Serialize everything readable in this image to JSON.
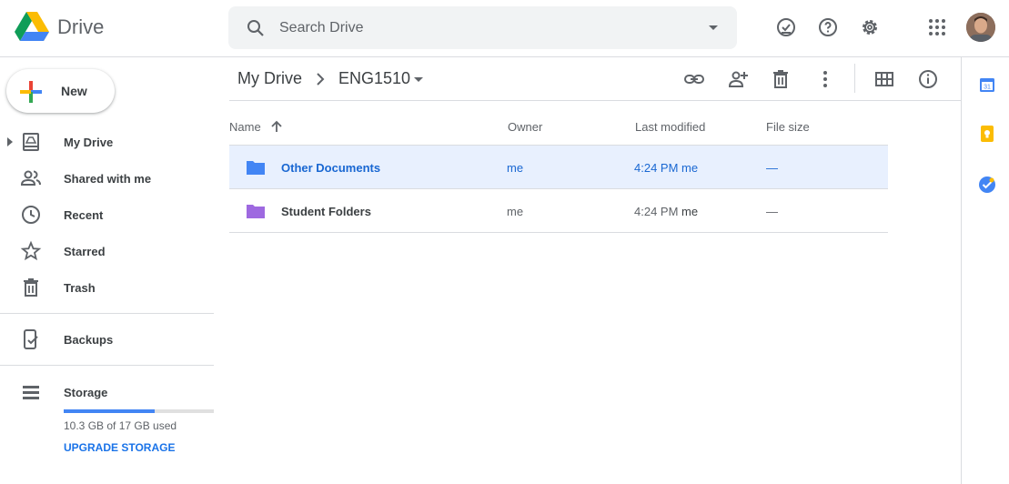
{
  "app": {
    "name": "Drive"
  },
  "search": {
    "placeholder": "Search Drive"
  },
  "header_icons": [
    "ready-for-offline-icon",
    "help-icon",
    "settings-icon",
    "apps-grid-icon",
    "avatar"
  ],
  "sidebar": {
    "new_label": "New",
    "items": [
      {
        "label": "My Drive",
        "icon": "my-drive-icon"
      },
      {
        "label": "Shared with me",
        "icon": "shared-icon"
      },
      {
        "label": "Recent",
        "icon": "clock-icon"
      },
      {
        "label": "Starred",
        "icon": "star-icon"
      },
      {
        "label": "Trash",
        "icon": "trash-icon"
      },
      {
        "label": "Backups",
        "icon": "backups-icon"
      },
      {
        "label": "Storage",
        "icon": "storage-icon"
      }
    ],
    "storage": {
      "used_fraction": 0.606,
      "text": "10.3 GB of 17 GB used",
      "upgrade_label": "UPGRADE STORAGE"
    }
  },
  "breadcrumb": {
    "root": "My Drive",
    "current": "ENG1510"
  },
  "table": {
    "headers": {
      "name": "Name",
      "owner": "Owner",
      "modified": "Last modified",
      "size": "File size"
    },
    "rows": [
      {
        "name": "Other Documents",
        "owner": "me",
        "modified": "4:24 PM",
        "modified_by": "me",
        "size": "—",
        "folder_color": "#4285f4",
        "selected": true
      },
      {
        "name": "Student Folders",
        "owner": "me",
        "modified": "4:24 PM",
        "modified_by": "me",
        "size": "—",
        "folder_color": "#9e69e0",
        "selected": false
      }
    ]
  },
  "colors": {
    "accent": "#1a73e8",
    "selected_row": "#e8f0fe"
  }
}
